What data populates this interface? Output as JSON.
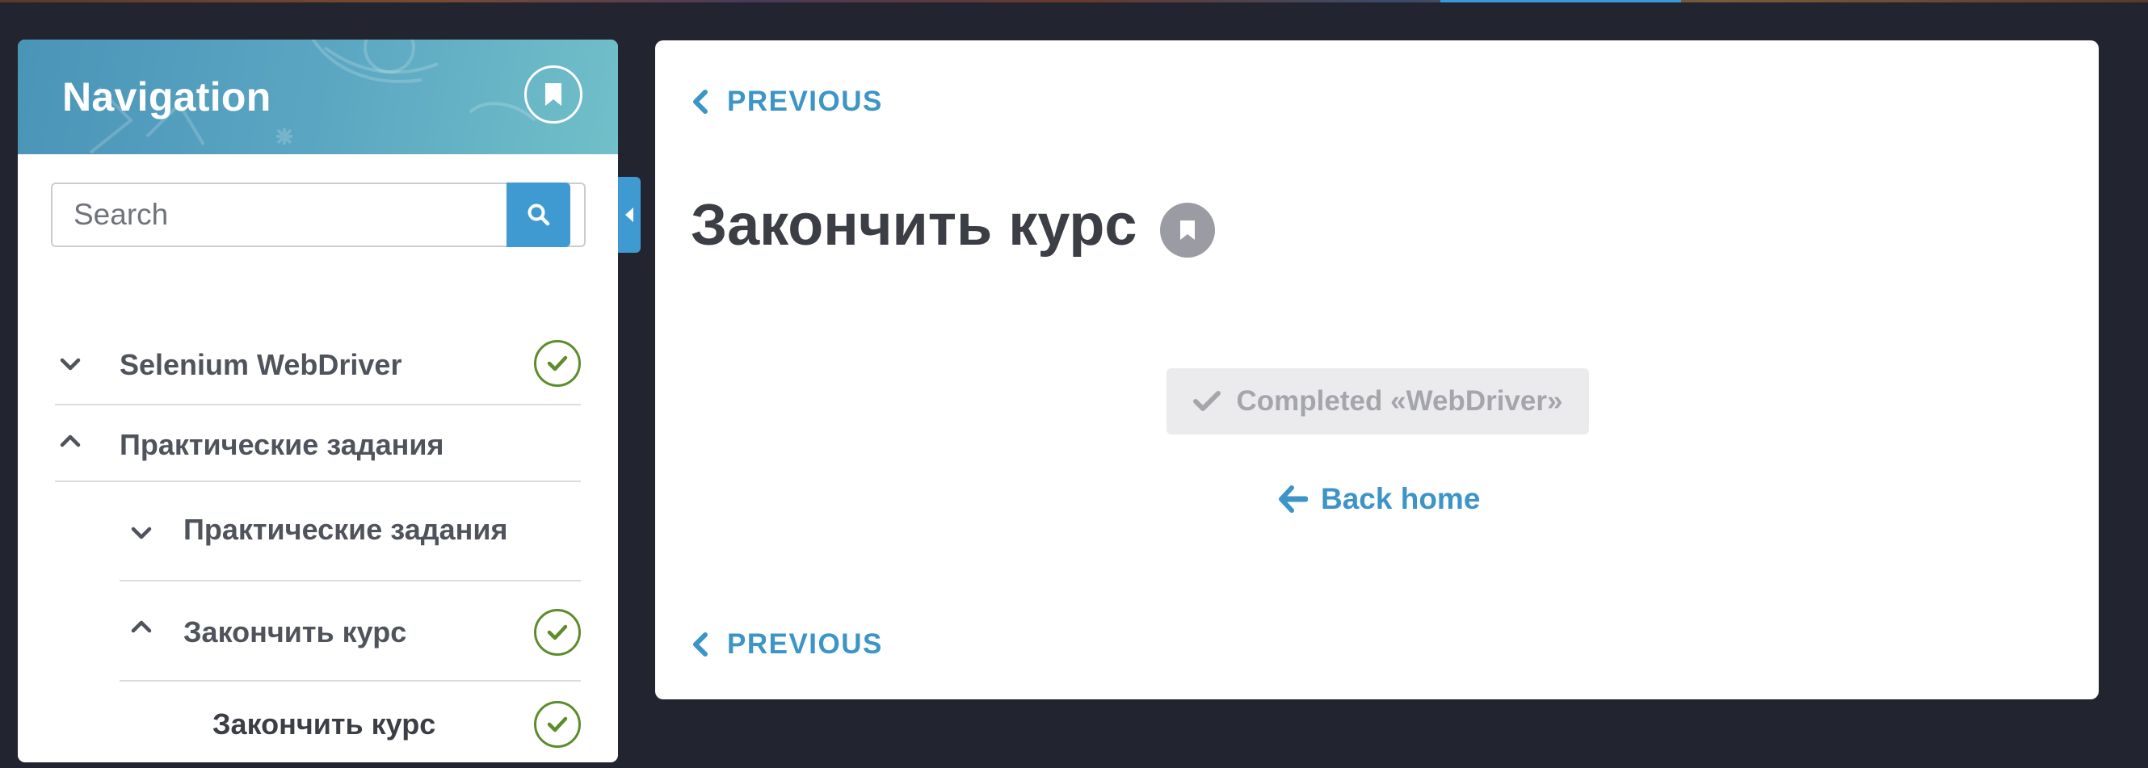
{
  "navigation": {
    "title": "Navigation",
    "search_placeholder": "Search",
    "tree": [
      {
        "label": "Selenium WebDriver",
        "expanded": false,
        "completed": true
      },
      {
        "label": "Практические задания",
        "expanded": true,
        "completed": false
      },
      {
        "label": "Практические задания",
        "expanded": false,
        "completed": false
      },
      {
        "label": "Закончить курс",
        "expanded": true,
        "completed": true
      },
      {
        "label": "Закончить курс",
        "completed": true
      }
    ]
  },
  "main": {
    "previous_top": "PREVIOUS",
    "title": "Закончить курс",
    "completed_label": "Completed «WebDriver»",
    "back_home": "Back home",
    "previous_bottom": "PREVIOUS"
  },
  "colors": {
    "accent": "#3f9ad2",
    "check_green": "#5d8c2b",
    "background": "#22252f"
  }
}
